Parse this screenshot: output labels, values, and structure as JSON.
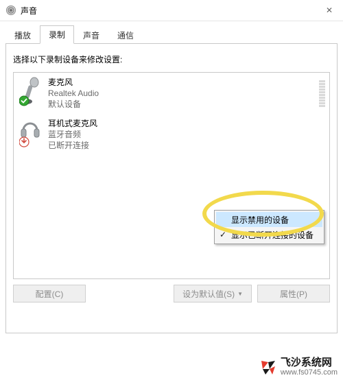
{
  "window": {
    "title": "声音"
  },
  "tabs": [
    {
      "label": "播放"
    },
    {
      "label": "录制",
      "active": true
    },
    {
      "label": "声音"
    },
    {
      "label": "通信"
    }
  ],
  "instruction": "选择以下录制设备来修改设置:",
  "devices": [
    {
      "name": "麦克风",
      "subtitle": "Realtek Audio",
      "status": "默认设备",
      "status_kind": "default"
    },
    {
      "name": "耳机式麦克风",
      "subtitle": "蓝牙音频",
      "status": "已断开连接",
      "status_kind": "disconnected"
    }
  ],
  "context_menu": {
    "items": [
      {
        "label": "显示禁用的设备",
        "hover": true,
        "checked": false
      },
      {
        "label": "显示已断开连接的设备",
        "hover": false,
        "checked": true
      }
    ]
  },
  "buttons": {
    "configure": "配置(C)",
    "set_default": "设为默认值(S)",
    "properties": "属性(P)"
  },
  "watermark": {
    "name": "飞沙系统网",
    "url": "www.fs0745.com"
  }
}
